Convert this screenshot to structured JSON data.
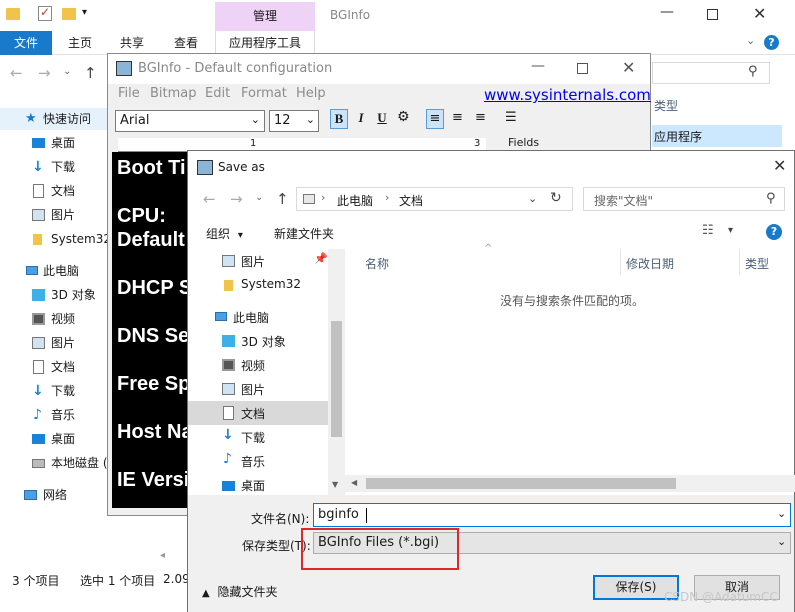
{
  "explorer": {
    "window_title": "BGInfo",
    "ribbon": {
      "context_tab": "管理",
      "tabs": [
        "文件",
        "主页",
        "共享",
        "查看",
        "应用程序工具"
      ]
    },
    "columns": {
      "type": "类型"
    },
    "selected_type": "应用程序",
    "nav_quick_access": "快速访问",
    "nav_pinned": [
      "桌面",
      "下载",
      "文档",
      "图片",
      "System32"
    ],
    "nav_this_pc": "此电脑",
    "nav_pc_items": [
      "3D 对象",
      "视频",
      "图片",
      "文档",
      "下载",
      "音乐",
      "桌面",
      "本地磁盘 (C:)"
    ],
    "nav_network": "网络",
    "status": {
      "items": "3 个项目",
      "selected": "选中 1 个项目",
      "size": "2.09"
    }
  },
  "bginfo": {
    "title": "BGInfo - Default configuration",
    "menu": [
      "File",
      "Bitmap",
      "Edit",
      "Format",
      "Help"
    ],
    "link": "www.sysinternals.com",
    "font_name": "Arial",
    "font_size": "12",
    "format_buttons": {
      "bold": "B",
      "italic": "I",
      "underline": "U"
    },
    "fields_label": "Fields",
    "ruler": {
      "one": "1",
      "three": "3"
    },
    "preview_lines": [
      "Boot Ti",
      "CPU:",
      "Default",
      "DHCP S",
      "DNS Se",
      "Free Sp",
      "Host Na",
      "IE Versi"
    ]
  },
  "save_dialog": {
    "title": "Save as",
    "breadcrumb": [
      "此电脑",
      "文档"
    ],
    "search_placeholder": "搜索\"文档\"",
    "toolbar": {
      "organize": "组织",
      "new_folder": "新建文件夹"
    },
    "nav": {
      "pinned_pictures": "图片",
      "system32": "System32",
      "this_pc": "此电脑",
      "items": [
        "3D 对象",
        "视频",
        "图片",
        "文档",
        "下载",
        "音乐",
        "桌面"
      ]
    },
    "columns": {
      "name": "名称",
      "modified": "修改日期",
      "type": "类型"
    },
    "empty_message": "没有与搜索条件匹配的项。",
    "filename_label": "文件名(N):",
    "filename_value": "bginfo",
    "filetype_label": "保存类型(T):",
    "filetype_value": "BGInfo Files (*.bgi)",
    "hide_folders": "隐藏文件夹",
    "save_button": "保存(S)",
    "cancel_button": "取消"
  },
  "watermark": "CSDN @AdatumCC",
  "colors": {
    "accent": "#1979ca",
    "highlight_box": "#e0272d",
    "context_tab": "#efd3f7"
  }
}
